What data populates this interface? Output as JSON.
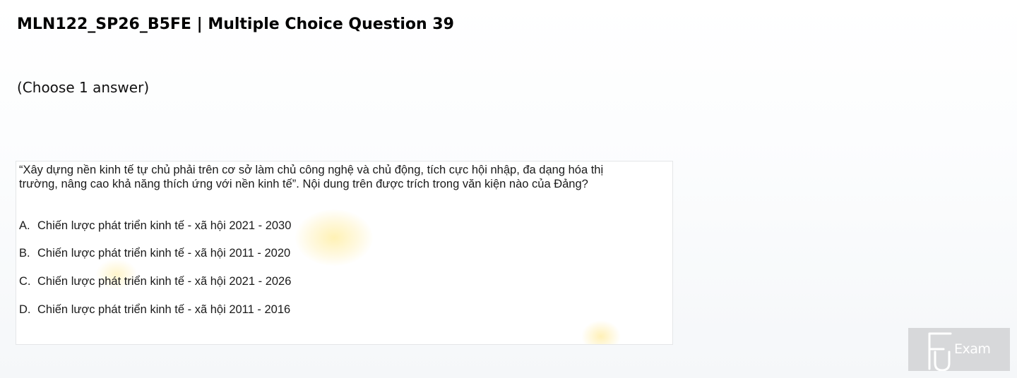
{
  "header": {
    "title": "MLN122_SP26_B5FE | Multiple Choice Question 39"
  },
  "instruction": "(Choose 1 answer)",
  "question": {
    "text": "“Xây dựng nền kinh tế tự chủ phải trên cơ sở làm chủ công nghệ và chủ động, tích cực hội nhập, đa dạng hóa thị trường, nâng cao khả năng thích ứng với nền kinh tế”. Nội dung trên được trích trong văn kiện nào của Đảng?",
    "options": [
      {
        "letter": "A.",
        "text": "Chiến lược phát triển kinh tế - xã hội 2021 - 2030"
      },
      {
        "letter": "B.",
        "text": "Chiến lược phát triển kinh tế - xã hội 2011 - 2020"
      },
      {
        "letter": "C.",
        "text": "Chiến lược phát triển kinh tế - xã hội 2021 - 2026"
      },
      {
        "letter": "D.",
        "text": "Chiến lược phát triển kinh tế - xã hội 2011 - 2016"
      }
    ]
  },
  "watermark": {
    "logo_text": "Exam",
    "logo_bg": "#d7d8da"
  }
}
